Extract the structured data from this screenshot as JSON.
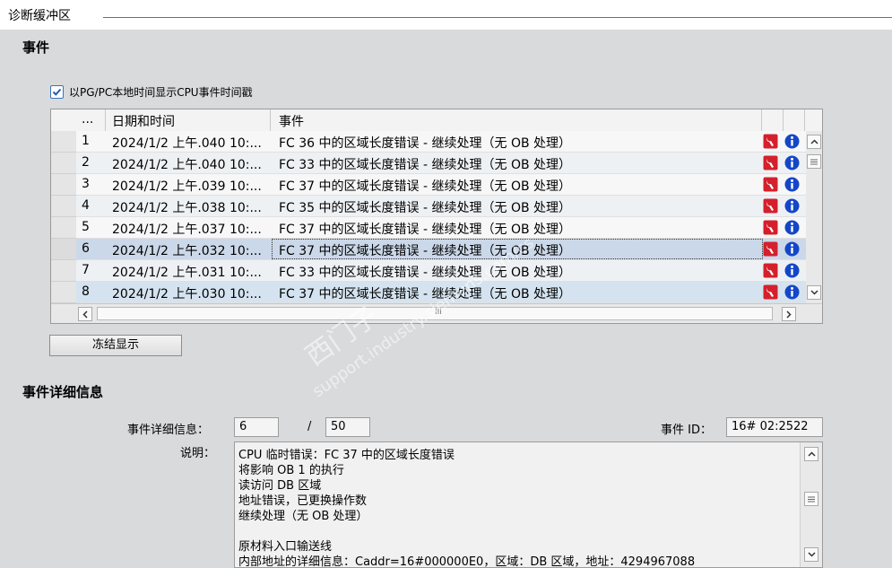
{
  "panel": {
    "title": "诊断缓冲区"
  },
  "events_section": {
    "title": "事件"
  },
  "checkbox": {
    "label": "以PG/PC本地时间显示CPU事件时间戳",
    "checked": true
  },
  "table": {
    "headers": {
      "num": "...",
      "datetime": "日期和时间",
      "event": "事件"
    },
    "rows": [
      {
        "num": "1",
        "datetime": "2024/1/2 上午.040 10:...",
        "event": "FC 36 中的区域长度错误 - 继续处理（无 OB 处理）"
      },
      {
        "num": "2",
        "datetime": "2024/1/2 上午.040 10:...",
        "event": "FC 33 中的区域长度错误 - 继续处理（无 OB 处理）"
      },
      {
        "num": "3",
        "datetime": "2024/1/2 上午.039 10:...",
        "event": "FC 37 中的区域长度错误 - 继续处理（无 OB 处理）"
      },
      {
        "num": "4",
        "datetime": "2024/1/2 上午.038 10:...",
        "event": "FC 35 中的区域长度错误 - 继续处理（无 OB 处理）"
      },
      {
        "num": "5",
        "datetime": "2024/1/2 上午.037 10:...",
        "event": "FC 37 中的区域长度错误 - 继续处理（无 OB 处理）"
      },
      {
        "num": "6",
        "datetime": "2024/1/2 上午.032 10:...",
        "event": "FC 37 中的区域长度错误 - 继续处理（无 OB 处理）"
      },
      {
        "num": "7",
        "datetime": "2024/1/2 上午.031 10:...",
        "event": "FC 33 中的区域长度错误 - 继续处理（无 OB 处理）"
      },
      {
        "num": "8",
        "datetime": "2024/1/2 上午.030 10:...",
        "event": "FC 37 中的区域长度错误 - 继续处理（无 OB 处理）"
      }
    ],
    "selected_row": 6,
    "hscroll_label": "III"
  },
  "freeze_button": {
    "label": "冻结显示"
  },
  "details_section": {
    "title": "事件详细信息"
  },
  "details": {
    "info_label": "事件详细信息：",
    "index": "6",
    "separator": "/",
    "total": "50",
    "event_id_label": "事件 ID：",
    "event_id": "16# 02:2522",
    "desc_label": "说明：",
    "desc_lines": [
      "CPU 临时错误：FC 37 中的区域长度错误",
      "将影响 OB 1 的执行",
      "读访问 DB 区域",
      "地址错误，已更换操作数",
      " 继续处理（无 OB 处理）",
      "",
      " 原材料入口输送线",
      "内部地址的详细信息：Caddr=16#000000E0，区域：DB 区域，地址：4294967088"
    ]
  },
  "watermark": {
    "line1": "西门子",
    "line2": "support.industry.siemens.com/cs"
  },
  "colors": {
    "accent": "#3b73b9",
    "selected_row": "#cbd8e9",
    "wrench_icon": "#d4202c",
    "info_icon": "#1446c8"
  }
}
